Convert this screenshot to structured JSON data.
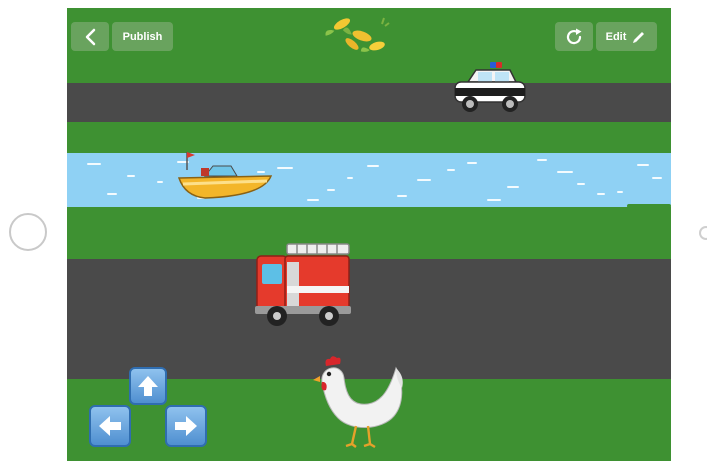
{
  "toolbar": {
    "back_icon": "chevron-left-icon",
    "publish_label": "Publish",
    "restart_icon": "restart-icon",
    "edit_label": "Edit",
    "edit_icon": "pencil-icon"
  },
  "scene": {
    "goal": "corn-icon",
    "player": "chicken-icon",
    "vehicles": [
      "police-car-icon",
      "speedboat-icon",
      "fire-engine-icon"
    ]
  },
  "controls": [
    "arrow-up-button",
    "arrow-left-button",
    "arrow-right-button"
  ],
  "colors": {
    "grass": "#3e9132",
    "road": "#4a4a4a",
    "water": "#8fd1f4",
    "arrow_button": "#5a9ad8"
  }
}
